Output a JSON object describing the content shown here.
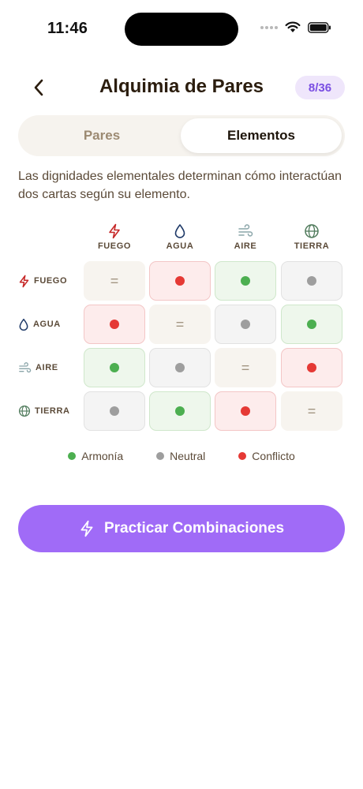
{
  "status_bar": {
    "time": "11:46"
  },
  "header": {
    "title": "Alquimia de Pares",
    "progress": "8/36"
  },
  "tabs": [
    {
      "label": "Pares",
      "active": false
    },
    {
      "label": "Elementos",
      "active": true
    }
  ],
  "description": "Las dignidades elementales determinan cómo interactúan dos cartas según su elemento.",
  "matrix": {
    "elements": [
      {
        "name": "FUEGO",
        "icon": "lightning-icon",
        "color": "#c62828"
      },
      {
        "name": "AGUA",
        "icon": "water-drop-icon",
        "color": "#1f3a68"
      },
      {
        "name": "AIRE",
        "icon": "wind-icon",
        "color": "#8aa5a9"
      },
      {
        "name": "TIERRA",
        "icon": "globe-icon",
        "color": "#4f7a5b"
      }
    ],
    "same_symbol": "=",
    "relations": [
      [
        "same",
        "conflict",
        "harmony",
        "neutral"
      ],
      [
        "conflict",
        "same",
        "neutral",
        "harmony"
      ],
      [
        "harmony",
        "neutral",
        "same",
        "conflict"
      ],
      [
        "neutral",
        "harmony",
        "conflict",
        "same"
      ]
    ]
  },
  "legend": [
    {
      "label": "Armonía",
      "type": "harmony",
      "color": "#4caf50"
    },
    {
      "label": "Neutral",
      "type": "neutral",
      "color": "#9e9e9e"
    },
    {
      "label": "Conflicto",
      "type": "conflict",
      "color": "#e53935"
    }
  ],
  "practice_button": {
    "label": "Practicar Combinaciones",
    "icon": "lightning-icon"
  },
  "colors": {
    "accent": "#a06bf7",
    "badge_bg": "#efe6fb",
    "badge_text": "#7a4ee3"
  }
}
